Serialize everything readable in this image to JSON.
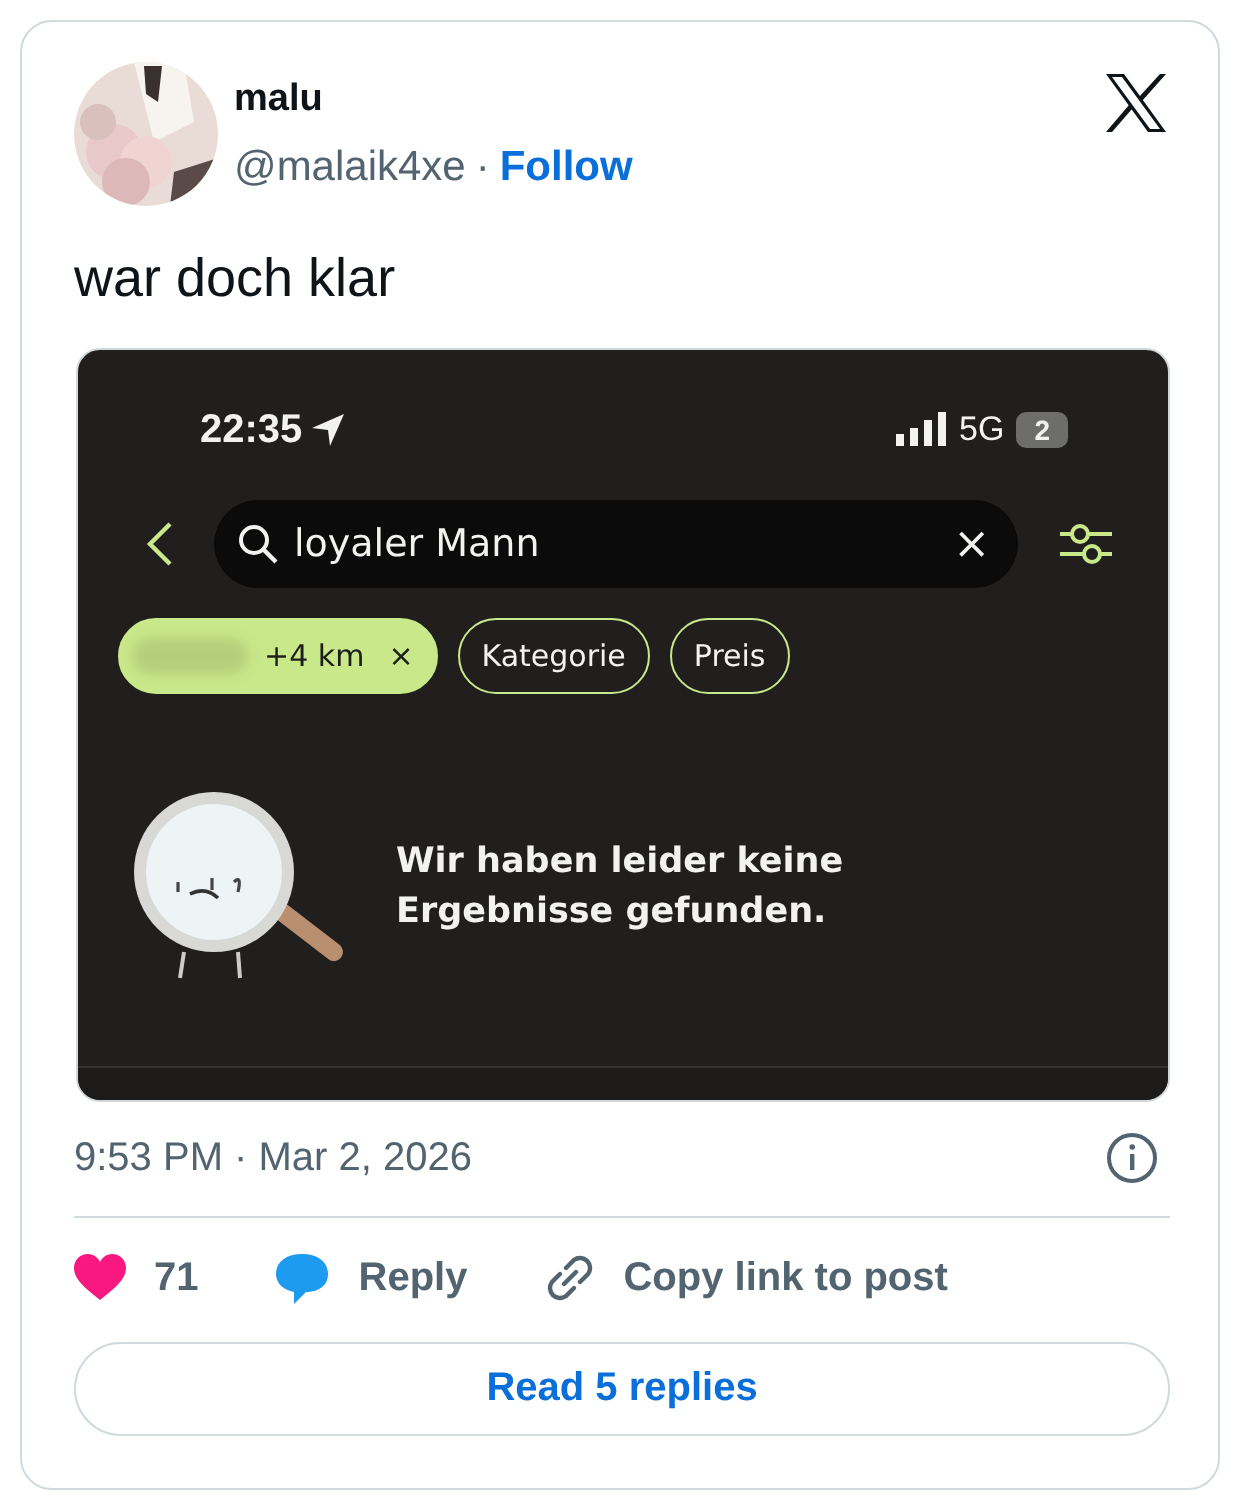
{
  "author": {
    "name": "malu",
    "handle": "@malaik4xe",
    "separator": "·",
    "follow": "Follow"
  },
  "text": "war doch klar",
  "screenshot": {
    "status_bar": {
      "time": "22:35",
      "network": "5G",
      "battery": "2"
    },
    "search": {
      "value": "loyaler Mann",
      "clear": "×"
    },
    "chips": [
      {
        "label": "+4 km",
        "remove": "×",
        "selected": true,
        "kind": "redacted"
      },
      {
        "label": "Kategorie",
        "selected": false,
        "kind": "plain"
      },
      {
        "label": "Preis",
        "selected": false,
        "kind": "plain"
      }
    ],
    "empty_message": "Wir haben leider keine Ergebnisse gefunden."
  },
  "timestamp": "9:53 PM · Mar 2, 2026",
  "actions": [
    {
      "kind": "like",
      "label": "71"
    },
    {
      "kind": "reply",
      "label": "Reply"
    },
    {
      "kind": "copy",
      "label": "Copy link to post"
    }
  ],
  "read_replies": "Read 5 replies"
}
